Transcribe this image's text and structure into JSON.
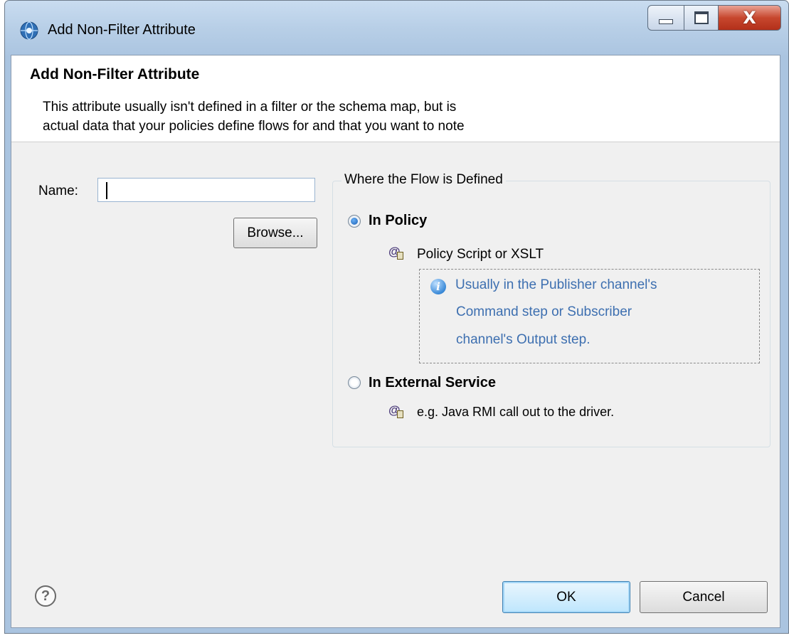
{
  "window": {
    "title": "Add Non-Filter Attribute",
    "icon": "app-globe-icon",
    "controls": [
      "minimize-icon",
      "maximize-icon",
      "close-icon"
    ],
    "close_glyph": "X"
  },
  "banner": {
    "title": "Add Non-Filter Attribute",
    "description_line1": "This attribute usually isn't defined in a filter or the schema map, but is",
    "description_line2": "actual data that your policies define flows for and that you want to note"
  },
  "form": {
    "name_label": "Name:",
    "name_value": "",
    "browse_label": "Browse..."
  },
  "flow_group": {
    "legend": "Where the Flow is Defined",
    "options": [
      {
        "label": "In Policy",
        "selected": true,
        "icon": "attribute-icon",
        "detail": "Policy Script or XSLT",
        "note_icon": "info-icon",
        "note_lines": [
          "Usually in the Publisher channel's",
          "Command step or Subscriber",
          "channel's Output step."
        ]
      },
      {
        "label": "In External Service",
        "selected": false,
        "icon": "attribute-icon",
        "detail": "e.g. Java RMI call out to the driver."
      }
    ]
  },
  "footer": {
    "help_icon": "help-icon",
    "help_glyph": "?",
    "ok_label": "OK",
    "cancel_label": "Cancel"
  },
  "colors": {
    "note_text": "#3d6fb0",
    "ok_border": "#3c7fb1",
    "close_button": "#c7472e"
  }
}
